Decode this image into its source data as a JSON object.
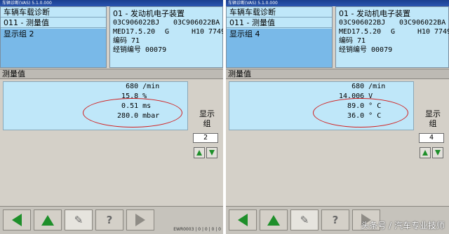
{
  "panes": [
    {
      "window_title": "车辆诊断(VAS) 5.1.0.000",
      "nav": {
        "function": "车辆车载诊断",
        "service": "011 - 测量值",
        "group": "显示组 2"
      },
      "info": {
        "title": "01 - 发动机电子装置",
        "part_left": "03C906022BJ",
        "part_right": "03C906022BA",
        "ecu": "MED17.5.20",
        "ecu_g": "G",
        "ecu_h": "H10",
        "ecu_num": "7749",
        "coding": "编码 71",
        "dealer": "经销编号 00079"
      },
      "section_label": "测量值",
      "values": [
        "    680 /min",
        "   15.8 %",
        "   0.51 ms",
        "  280.0 mbar"
      ],
      "side_label": "显示组",
      "group_number": "2",
      "status_text": "EWR0003 | 0 | 0 | 0 | 0"
    },
    {
      "window_title": "车辆诊断(VAS) 5.1.0.000",
      "nav": {
        "function": "车辆车载诊断",
        "service": "011 - 测量值",
        "group": "显示组 4"
      },
      "info": {
        "title": "01 - 发动机电子装置",
        "part_left": "03C906022BJ",
        "part_right": "03C906022BA",
        "ecu": "MED17.5.20",
        "ecu_g": "G",
        "ecu_h": "H10",
        "ecu_num": "7749",
        "coding": "编码 71",
        "dealer": "经销编号 00079"
      },
      "section_label": "测量值",
      "values": [
        "    680 /min",
        " 14.006 V",
        "   89.0 ° C",
        "   36.0 ° C"
      ],
      "side_label": "显示组",
      "group_number": "4",
      "status_text": ""
    }
  ],
  "watermark": "头条号 / 汽车专业技师",
  "colors": {
    "panel_cyan": "#bfe7f9",
    "selected_blue": "#79b9e8",
    "arrow_green": "#1e8f2a",
    "highlight_red": "#d21e1e"
  }
}
